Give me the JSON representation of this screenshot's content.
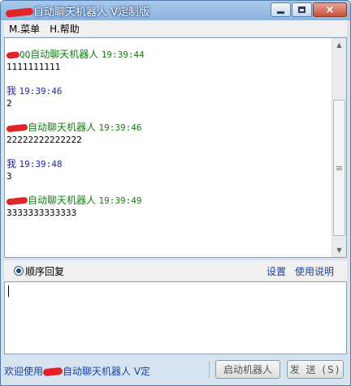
{
  "window": {
    "title": "自动聊天机器人 V定制版",
    "title_prefix_visible": "PY",
    "buttons": {
      "minimize": "minimize",
      "maximize": "maximize",
      "close": "×"
    }
  },
  "menu": [
    {
      "label": "M.菜单"
    },
    {
      "label": "H.帮助"
    }
  ],
  "messages": [
    {
      "sender_prefix": "QQ",
      "sender": "自动聊天机器人",
      "time": "19:39:44",
      "text": "1111111111",
      "role": "bot"
    },
    {
      "sender_prefix": "",
      "sender": "我",
      "time": "19:39:46",
      "text": "2",
      "role": "me"
    },
    {
      "sender_prefix": "QQ",
      "sender": "自动聊天机器人",
      "time": "19:39:46",
      "text": "22222222222222",
      "role": "bot"
    },
    {
      "sender_prefix": "",
      "sender": "我",
      "time": "19:39:48",
      "text": "3",
      "role": "me"
    },
    {
      "sender_prefix": "QQ",
      "sender": "自动聊天机器人",
      "time": "19:39:49",
      "text": "3333333333333",
      "role": "bot"
    }
  ],
  "toolbar": {
    "radio_label": "顺序回复",
    "settings_link": "设置",
    "help_link": "使用说明"
  },
  "input": {
    "value": ""
  },
  "status": {
    "prefix": "欢迎使用",
    "suffix": "自动聊天机器人 V定"
  },
  "buttons": {
    "start": "启动机器人",
    "send": "发 送 (S)"
  },
  "colors": {
    "bot": "#118011",
    "me": "#1a22c8",
    "link": "#1a3fa6",
    "redaction": "#e0242a"
  }
}
